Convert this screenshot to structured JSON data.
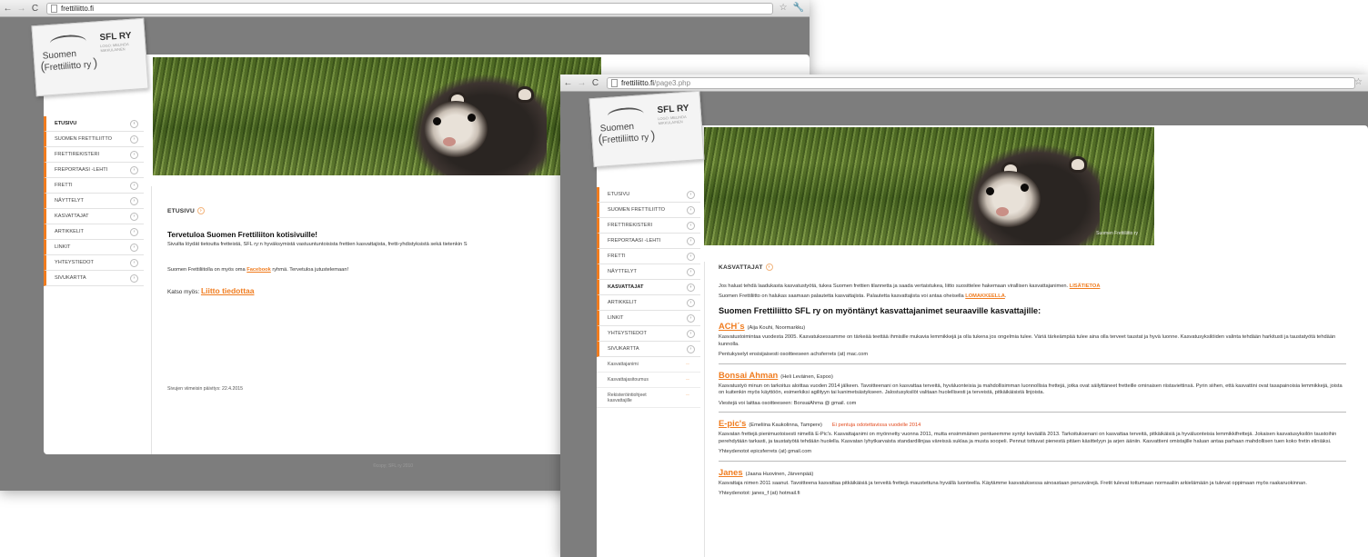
{
  "window1": {
    "url": "frettiliitto.fi",
    "url_path": "",
    "logo": {
      "line1": "Suomen",
      "line2": "Frettiliitto ry",
      "org": "SFL RY",
      "credit": "LOGO: MELINDA MIKKULAINEN"
    },
    "nav": [
      "ETUSIVU",
      "SUOMEN FRETTILIITTO",
      "FRETTIREKISTERI",
      "FREPORTAASI -LEHTI",
      "FRETTI",
      "NÄYTTELYT",
      "KASVATTAJAT",
      "ARTIKKELIT",
      "LINKIT",
      "YHTEYSTIEDOT",
      "SIVUKARTTA"
    ],
    "active_index": 0,
    "heading": "ETUSIVU",
    "welcome_title": "Tervetuloa Suomen Frettiliiton kotisivuille!",
    "intro": "Sivuilta löydät tietoutta fretteistä, SFL ry:n hyväksymistä vastuuntuntoisista frettien kasvattajista, fretti-yhdistyksistä sekä tietenkin S",
    "facebook": {
      "before": "Suomen Frettiliitolla on myös oma ",
      "link": "Facebook",
      "after": " ryhmä. Tervetuloa jutustelemaan!"
    },
    "see_also": {
      "label": "Katso myös: ",
      "link": "Liitto tiedottaa"
    },
    "updated": "Sivujen viimeisin päivitys: 22.4.2015",
    "footer": "©copy; SFL ry 2010"
  },
  "window2": {
    "url": "frettiliitto.fi",
    "url_path": "/page3.php",
    "logo": {
      "line1": "Suomen",
      "line2": "Frettiliitto ry",
      "org": "SFL RY",
      "credit": "LOGO: MELINDA MIKKULAINEN"
    },
    "hero_caption": "Suomen Frettiliitto ry",
    "nav": [
      "ETUSIVU",
      "SUOMEN FRETTILIITTO",
      "FRETTIREKISTERI",
      "FREPORTAASI -LEHTI",
      "FRETTI",
      "NÄYTTELYT",
      "KASVATTAJAT",
      "ARTIKKELIT",
      "LINKIT",
      "YHTEYSTIEDOT",
      "SIVUKARTTA"
    ],
    "active_index": 6,
    "sub_nav": [
      "Kasvattajanimi",
      "Kasvattajasitoumus",
      "Rekisteröintiohjeet kasvattajille"
    ],
    "heading": "KASVATTAJAT",
    "intro1": {
      "text": "Jos haluat tehdä laadukasta kasvatustyötä, tukea Suomen frettien tilannetta ja saada vertaistukea, liitto suosittelee hakemaan virallisen kasvattajanimen. ",
      "link": "LISÄTIETOA"
    },
    "intro2": {
      "text": "Suomen Frettiliitto on halukas saamaan palautetta kasvattajista. Palautetta kasvattajista voi antaa oheisella ",
      "link": "LOMAKKEELLA",
      "after": "."
    },
    "big_heading": "Suomen Frettiliitto SFL ry on myöntänyt kasvattajanimet seuraaville kasvattajille:",
    "breeders": [
      {
        "name": "ACH´s",
        "owner": "(Aija Kouhi, Noormarkku)",
        "notice": "",
        "desc": "Kasvatustoimintaa vuodesta 2005. Kasvatuksessamme on tärkeää teettää ihmisille mukavia lemmikkejä ja olla tukena jos ongelmia tulee. Väriä tärkeämpää tulee aina olla terveet taustat ja hyvä luonne. Kasvatusyksilöiden valinta tehdään harkitusti ja taustatyötä tehdään kunnolla.",
        "contact": "Pentukyselyt ensisijaisesti osoitteeseen achsferrets (at) mac.com"
      },
      {
        "name": "Bonsai Ahman",
        "owner": "(Heli Leväinen, Espoo)",
        "notice": "",
        "desc": "Kasvatustyö minun on tarkoitus aloittaa vuoden 2014 jälkeen. Tavoitteenani on kasvattaa terveitä, hyväluonteisia ja mahdollisimman luonnollisia frettejä, jotka ovat säilyttäneet fretteille ominaisen riistaviettinsä. Pyrin siihen, että kasvattini ovat tasapainoisia lemmikkejä, joista on kuitenkin myös käyttöön, esimerkiksi agilityyn tai kanimetsästykseen. Jalostusyksilöt valitaan huolellisesti ja terveistä, pitkäikäisistä linjoista.",
        "contact": "Viestejä voi laittaa osoitteeseen: BonsaiAhma @ gmail. com"
      },
      {
        "name": "E-pic's",
        "owner": "(Emeliina Kaukolinna, Tampere)",
        "notice": "Ei pentuja odotettavissa vuodelle 2014",
        "desc": "Kasvatan frettejä pienimuotoisesti nimellä E-Pic's. Kasvattajanimi on myönnetty vuonna 2011, mutta ensimmäinen pentueemme syntyi keväällä 2013. Tarkoituksenani on kasvattaa terveitä, pitkäikäisiä ja hyväluonteisia lemmikkifrettejä. Jokaisen kasvatusyksilön taustoihin perehdytään tarkasti, ja taustatyötä tehdään huolella. Kasvatan lyhytkarvaista standardilinjaa väreissä suklaa ja musta soopeli. Pennut tottuvat pienestä pitäen käsittelyyn ja arjen ääniin. Kasvattieni omistajille haluan antaa parhaan mahdollisen tuen koko fretin eliniäksi.",
        "contact": "Yhteydenotot epicsferrets (at) gmail.com"
      },
      {
        "name": "Janes",
        "owner": "(Jaana Huovinen, Järvenpää)",
        "notice": "",
        "desc": "Kasvattaja nimen 2011 saanut. Tavoitteena kasvattaa pitkäikäisiä ja terveitä frettejä maustettuna hyvällä luonteella. Käytämme kasvatuksessa ainoastaan perusvärejä. Fretit tulevat tottumaan normaaliin arkielämään ja tulevat oppimaan myös raakaruokinnan.",
        "contact": "Yhteydenotot: janes_f (at) hotmail.fi"
      }
    ]
  }
}
